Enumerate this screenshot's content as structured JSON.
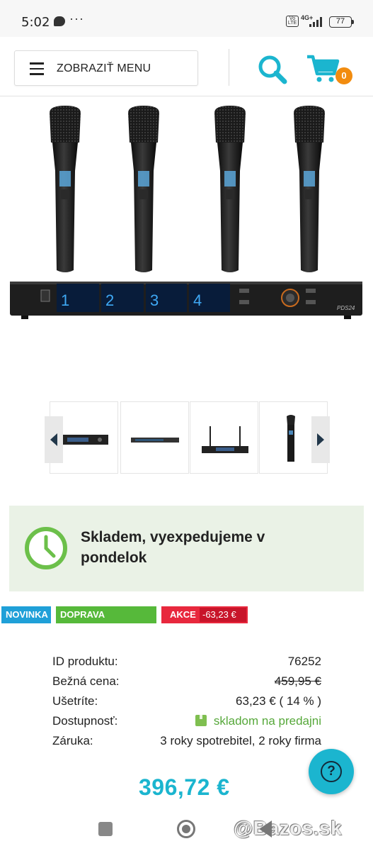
{
  "status_bar": {
    "time": "5:02",
    "dots": "···",
    "volte": "Vo LTE",
    "network": "4G+",
    "battery": "77"
  },
  "header": {
    "menu_label": "ZOBRAZIŤ MENU",
    "cart_count": "0"
  },
  "gallery": {
    "model_label": "PDS24",
    "channels": [
      "1",
      "2",
      "3",
      "4"
    ],
    "thumbnails": [
      "receiver-rack-front",
      "receiver-slim",
      "receiver-antennas",
      "handheld-mic"
    ]
  },
  "stock": {
    "message": "Skladem, vyexpedujeme v pondelok"
  },
  "badges": {
    "new": "NOVINKA",
    "free_shipping": "DOPRAVA ZADARMO",
    "sale": "AKCE",
    "sale_amount": "-63,23 €"
  },
  "info": {
    "rows": [
      {
        "label": "ID produktu:",
        "value": "76252"
      },
      {
        "label": "Bežná cena:",
        "value": "459,95 €"
      },
      {
        "label": "Ušetríte:",
        "value": "63,23 € ( 14 % )"
      },
      {
        "label": "Dostupnosť:",
        "value": "skladom na predajni"
      },
      {
        "label": "Záruka:",
        "value": "3 roky spotrebitel, 2 roky firma"
      }
    ]
  },
  "price": "396,72 €",
  "help_symbol": "?",
  "watermark": "@Bazos.sk",
  "colors": {
    "accent": "#1bb5cf",
    "cart_badge": "#f28c0f",
    "stock_bg": "#eaf2e6",
    "badge_new": "#1fa0d8",
    "badge_free": "#56b93a",
    "badge_sale": "#e8283d"
  }
}
